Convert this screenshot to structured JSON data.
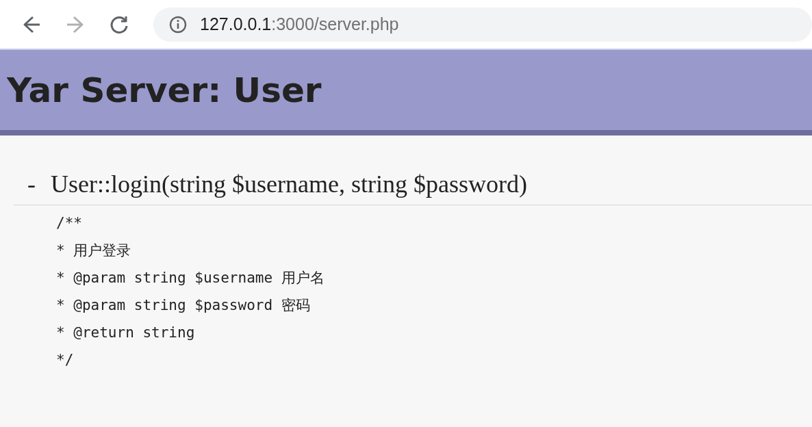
{
  "browser": {
    "nav_buttons": [
      {
        "kind": "back",
        "disabled": false
      },
      {
        "kind": "forward",
        "disabled": true
      },
      {
        "kind": "reload",
        "disabled": false
      }
    ],
    "address": {
      "host": "127.0.0.1",
      "path": ":3000/server.php"
    }
  },
  "header": {
    "title": "Yar Server: User"
  },
  "methods": [
    {
      "toggle": "-",
      "signature": "User::login(string $username, string $password)",
      "doc": [
        "/**",
        "* 用户登录",
        "* @param string $username 用户名",
        "* @param string $password 密码",
        "* @return string",
        "*/"
      ]
    }
  ]
}
